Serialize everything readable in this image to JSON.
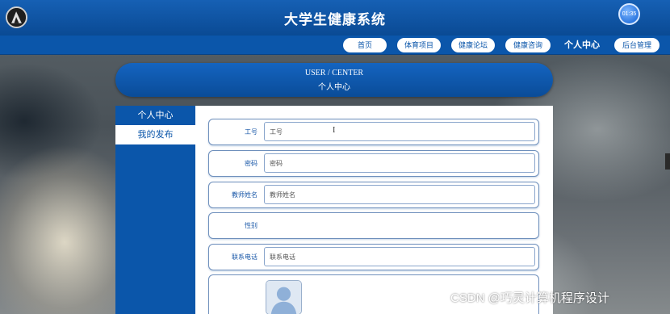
{
  "header": {
    "logo_icon": "avatar-logo-icon",
    "title": "大学生健康系统",
    "clock_text": "01:35"
  },
  "nav": {
    "items": [
      {
        "label": "首页"
      },
      {
        "label": "体育项目"
      },
      {
        "label": "健康论坛"
      },
      {
        "label": "健康咨询"
      },
      {
        "label": "个人中心",
        "active": true
      },
      {
        "label": "后台管理"
      }
    ]
  },
  "banner": {
    "en": "USER / CENTER",
    "cn": "个人中心"
  },
  "sidebar": {
    "items": [
      {
        "label": "个人中心",
        "active": true
      },
      {
        "label": "我的发布"
      }
    ]
  },
  "form": {
    "fields": [
      {
        "label": "工号",
        "placeholder": "工号"
      },
      {
        "label": "密码",
        "placeholder": "密码"
      },
      {
        "label": "教师姓名",
        "placeholder": "教师姓名"
      },
      {
        "label": "性别",
        "placeholder": ""
      },
      {
        "label": "联系电话",
        "placeholder": "联系电话"
      }
    ],
    "avatar_icon": "default-avatar-icon"
  },
  "watermark": "CSDN @巧灵计算机程序设计",
  "colors": {
    "primary": "#0b56aa",
    "header": "#1660b4",
    "label": "#1a58a8",
    "white": "#ffffff"
  }
}
